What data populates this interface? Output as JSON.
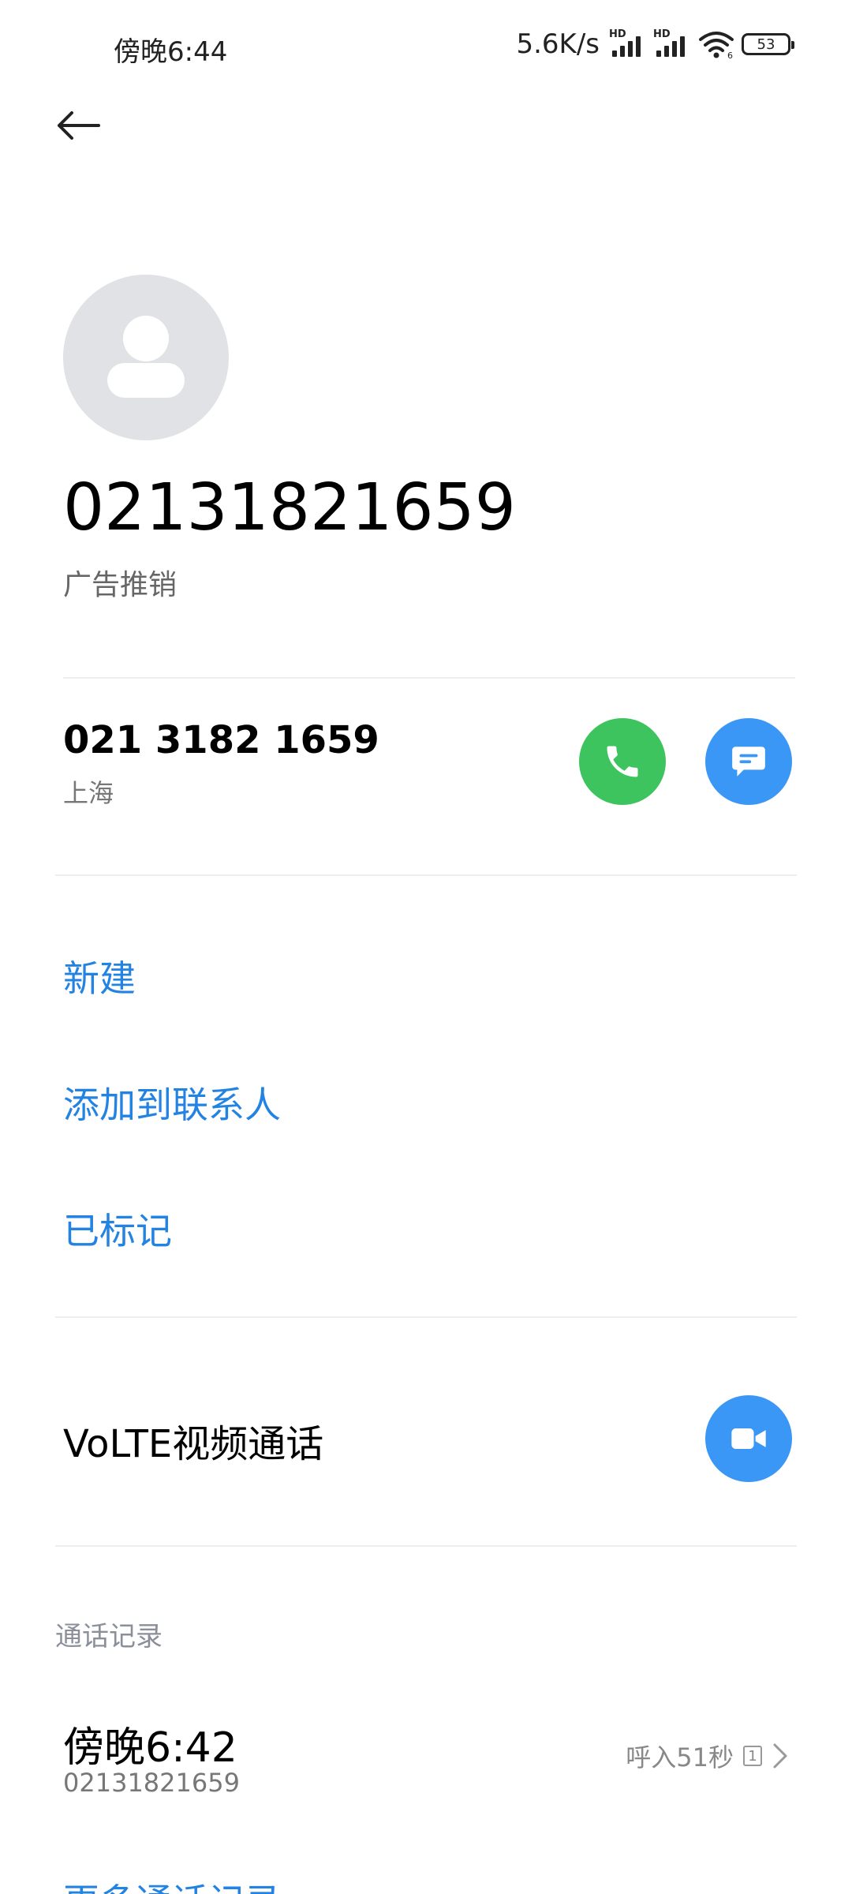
{
  "status_bar": {
    "time": "傍晚6:44",
    "net_speed": "5.6K/s",
    "signal_hd_1": "HD",
    "signal_hd_2": "HD",
    "wifi_label": "6",
    "battery": "53"
  },
  "header": {
    "back_icon": "arrow-left-icon"
  },
  "contact": {
    "avatar_icon": "person-placeholder-icon",
    "number": "02131821659",
    "tag": "广告推销"
  },
  "phone_row": {
    "number": "021 3182 1659",
    "location": "上海",
    "call_icon": "phone-icon",
    "message_icon": "message-icon",
    "call_color": "#3dc45e",
    "message_color": "#3a97f5"
  },
  "actions": [
    {
      "label": "新建"
    },
    {
      "label": "添加到联系人"
    },
    {
      "label": "已标记"
    }
  ],
  "volte": {
    "label": "VoLTE视频通话",
    "icon": "video-camera-icon"
  },
  "call_log": {
    "header": "通话记录",
    "entries": [
      {
        "time": "傍晚6:42",
        "number": "02131821659",
        "desc": "呼入51秒",
        "sim": "1"
      }
    ],
    "more": "更多通话记录"
  },
  "accent_color": "#2383e2"
}
